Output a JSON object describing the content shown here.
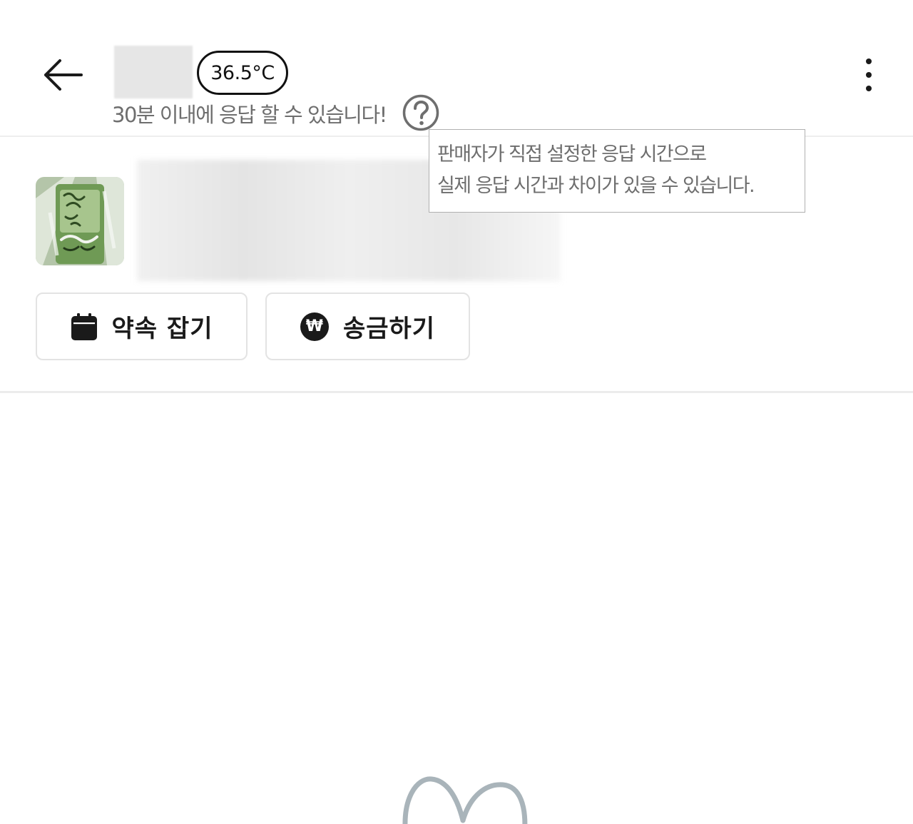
{
  "header": {
    "back_icon": "arrow-left-icon",
    "temperature": "36.5°C",
    "response_note": "30분 이내에 응답 할 수 있습니다!",
    "help_icon": "question-circle-icon",
    "more_icon": "more-vertical-icon"
  },
  "tooltip": {
    "line1": "판매자가 직접 설정한 응답 시간으로",
    "line2": "실제 응답 시간과 차이가 있을 수 있습니다."
  },
  "product": {
    "thumbnail": "product-thumbnail-image"
  },
  "actions": {
    "appointment_label": "약속 잡기",
    "appointment_icon": "calendar-icon",
    "transfer_label": "송금하기",
    "transfer_icon": "won-coin-icon",
    "won_symbol": "₩"
  },
  "colors": {
    "text_primary": "#1a1a1a",
    "text_secondary": "#6e6e6e",
    "border": "#e3e3e3",
    "graphic": "#a9b4ba"
  }
}
